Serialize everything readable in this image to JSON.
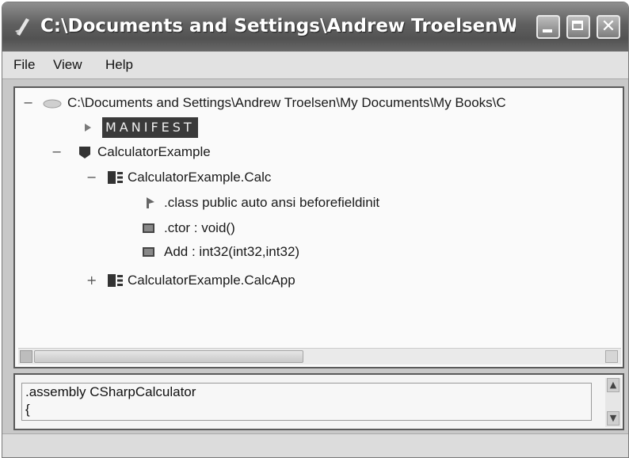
{
  "window": {
    "title": "C:\\Documents and Settings\\Andrew TroelsenW...",
    "close_glyph": "✕"
  },
  "menu": {
    "file": "File",
    "view": "View",
    "help": "Help"
  },
  "tree": {
    "root_path": "C:\\Documents and Settings\\Andrew Troelsen\\My Documents\\My Books\\C",
    "manifest": "MANIFEST",
    "namespace": "CalculatorExample",
    "class_calc": "CalculatorExample.Calc",
    "class_directive": ".class public auto ansi beforefieldinit",
    "member_ctor": ".ctor : void()",
    "member_add": "Add : int32(int32,int32)",
    "class_calcapp": "CalculatorExample.CalcApp"
  },
  "code": {
    "line1": ".assembly CSharpCalculator",
    "line2": "{"
  }
}
